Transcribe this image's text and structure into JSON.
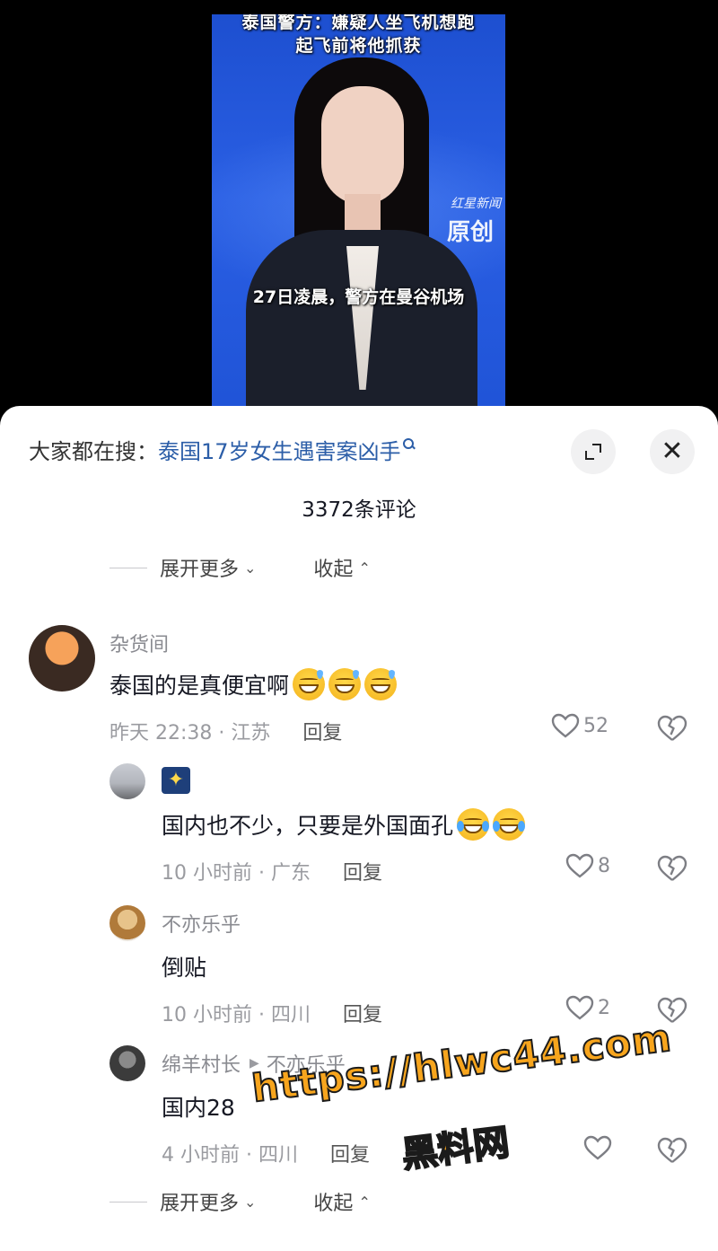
{
  "video": {
    "headline_line1": "泰国警方：嫌疑人坐飞机想跑",
    "headline_line2": "起飞前将他抓获",
    "watermark_small": "红星新闻",
    "watermark_big": "原创",
    "caption": "27日凌晨，警方在曼谷机场",
    "background_color": "#2a5fe4"
  },
  "sheet": {
    "search_prefix": "大家都在搜：",
    "search_term": "泰国17岁女生遇害案凶手",
    "search_icon": "search-icon",
    "expand_icon": "expand-icon",
    "close_icon": "close-icon",
    "close_glyph": "✕",
    "comment_count": "3372条评论",
    "expand_more": "展开更多",
    "collapse": "收起",
    "accent_link_color": "#2c5ea8"
  },
  "comments": [
    {
      "username": "杂货间",
      "text": "泰国的是真便宜啊",
      "emojis": [
        "sweat-smile",
        "sweat-smile",
        "sweat-smile"
      ],
      "time_location": "昨天 22:38 · 江苏",
      "reply_label": "回复",
      "likes": "52"
    },
    {
      "username": "",
      "username_icon": "sparkle-icon",
      "text": "国内也不少，只要是外国面孔",
      "emojis": [
        "tears-of-joy",
        "tears-of-joy"
      ],
      "time_location": "10 小时前 · 广东",
      "reply_label": "回复",
      "likes": "8"
    },
    {
      "username": "不亦乐乎",
      "text": "倒贴",
      "emojis": [],
      "time_location": "10 小时前 · 四川",
      "reply_label": "回复",
      "likes": "2"
    },
    {
      "username": "绵羊村长",
      "reply_to": "不亦乐乎",
      "text": "国内28",
      "emojis": [],
      "time_location": "4 小时前 · 四川",
      "reply_label": "回复",
      "likes": ""
    }
  ],
  "overlay_watermark": {
    "url": "https://hlwc44.com",
    "name": "黑料网",
    "color": "#f7a51d"
  }
}
